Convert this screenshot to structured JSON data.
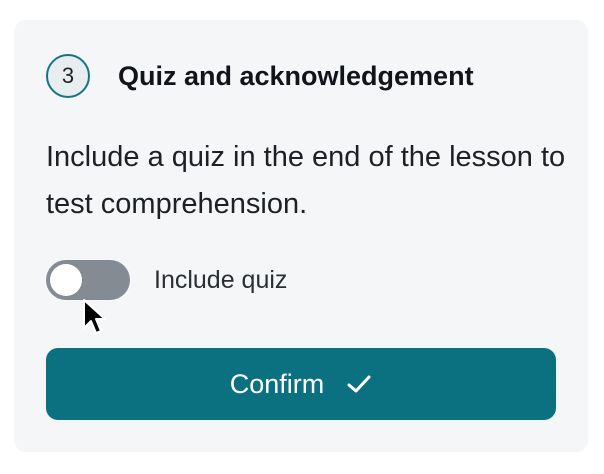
{
  "step": {
    "number": "3",
    "title": "Quiz and acknowledgement"
  },
  "description": "Include a quiz in the end of the lesson to test comprehension.",
  "toggle": {
    "label": "Include quiz",
    "state": "off"
  },
  "confirm_button": {
    "label": "Confirm",
    "icon": "check-icon"
  },
  "colors": {
    "accent": "#0b7080",
    "toggle_off": "#858b92",
    "card_background": "#f5f6f8"
  }
}
